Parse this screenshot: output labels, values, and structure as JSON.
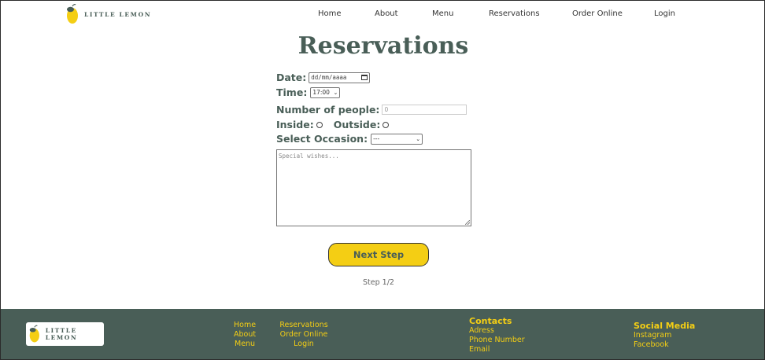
{
  "brand": {
    "name": "LITTLE LEMON"
  },
  "nav": {
    "items": [
      "Home",
      "About",
      "Menu",
      "Reservations",
      "Order Online",
      "Login"
    ]
  },
  "page": {
    "title": "Reservations"
  },
  "form": {
    "date_label": "Date:",
    "date_placeholder": "dd/mm/aaaa",
    "time_label": "Time:",
    "time_value": "17:00",
    "people_label": "Number of people:",
    "people_value": "0",
    "inside_label": "Inside:",
    "outside_label": "Outside:",
    "occasion_label": "Select Occasion:",
    "occasion_value": "---",
    "wishes_placeholder": "Special wishes..."
  },
  "actions": {
    "next_label": "Next Step",
    "step_text": "Step 1/2"
  },
  "footer": {
    "links_col1": [
      "Home",
      "About",
      "Menu"
    ],
    "links_col2": [
      "Reservations",
      "Order Online",
      "Login"
    ],
    "contacts_title": "Contacts",
    "contacts": [
      "Adress",
      "Phone Number",
      "Email"
    ],
    "social_title": "Social Media",
    "social": [
      "Instagram",
      "Facebook"
    ]
  },
  "colors": {
    "primary_green": "#495e57",
    "primary_yellow": "#f4ce14"
  },
  "icons": {
    "logo": "lemon-icon",
    "date": "calendar-icon",
    "select": "chevron-down-icon"
  }
}
